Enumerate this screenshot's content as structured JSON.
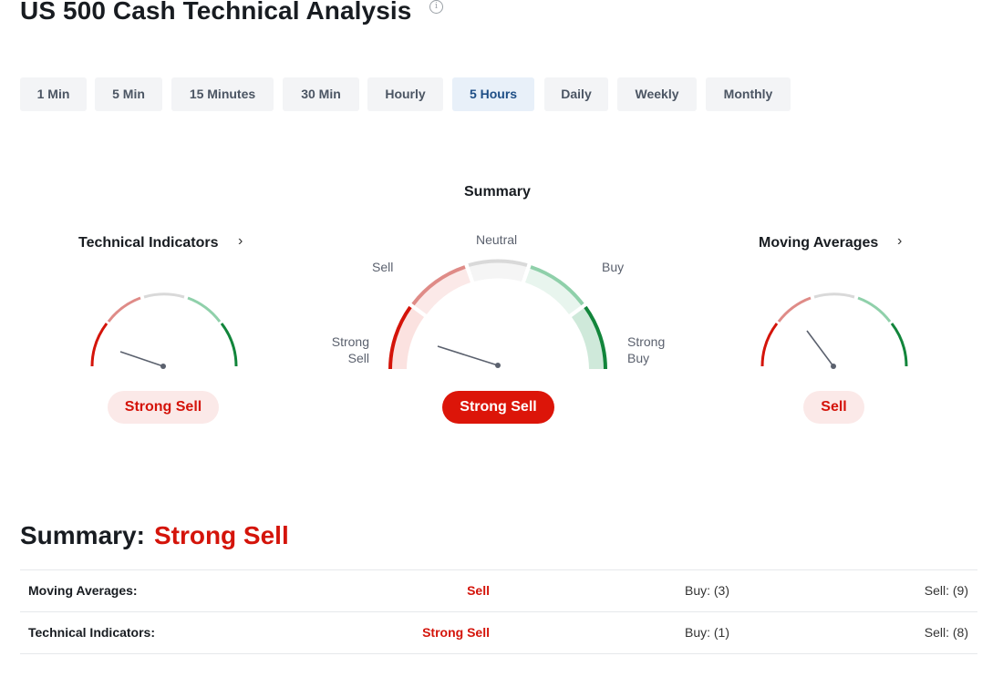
{
  "header": {
    "title": "US 500 Cash Technical Analysis",
    "info_icon": "info-icon"
  },
  "timeframes": {
    "active": "5 Hours",
    "items": [
      "1 Min",
      "5 Min",
      "15 Minutes",
      "30 Min",
      "Hourly",
      "5 Hours",
      "Daily",
      "Weekly",
      "Monthly"
    ]
  },
  "gauges": {
    "technical_indicators": {
      "title": "Technical Indicators",
      "verdict": "Strong Sell",
      "needle_level": "Strong Sell"
    },
    "summary": {
      "title": "Summary",
      "verdict": "Strong Sell",
      "needle_level": "Strong Sell",
      "scale_labels": {
        "strong_sell": "Strong\nSell",
        "sell": "Sell",
        "neutral": "Neutral",
        "buy": "Buy",
        "strong_buy": "Strong\nBuy"
      }
    },
    "moving_averages": {
      "title": "Moving Averages",
      "verdict": "Sell",
      "needle_level": "Sell"
    }
  },
  "summary_section": {
    "label": "Summary:",
    "verdict": "Strong Sell",
    "rows": [
      {
        "name": "Moving Averages:",
        "signal": "Sell",
        "buy": "Buy: (3)",
        "sell": "Sell: (9)"
      },
      {
        "name": "Technical Indicators:",
        "signal": "Strong Sell",
        "buy": "Buy: (1)",
        "sell": "Sell: (8)"
      }
    ]
  },
  "colors": {
    "strong_sell": "#d4140a",
    "sell": "#df8b87",
    "neutral": "#d9d9d9",
    "buy": "#8fd0aa",
    "strong_buy": "#12853b",
    "active_tab_bg": "#e8f0f9",
    "active_tab_text": "#1e4e86"
  }
}
